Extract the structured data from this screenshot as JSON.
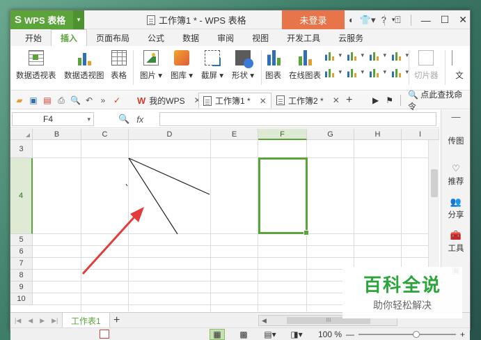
{
  "titlebar": {
    "app_name": "WPS 表格",
    "doc_title": "工作簿1 * - WPS 表格",
    "login": "未登录",
    "help": "?"
  },
  "menu": {
    "tabs": [
      "开始",
      "插入",
      "页面布局",
      "公式",
      "数据",
      "审阅",
      "视图",
      "开发工具",
      "云服务"
    ],
    "active": "插入"
  },
  "ribbon": {
    "pivot_table": "数据透视表",
    "pivot_chart": "数据透视图",
    "table": "表格",
    "picture": "图片",
    "gallery": "图库",
    "screenshot": "截屏",
    "shapes": "形状",
    "chart": "图表",
    "online_chart": "在线图表",
    "slicer": "切片器",
    "text": "文"
  },
  "doctabs": {
    "my_wps": "我的WPS",
    "book1": "工作簿1 *",
    "book2": "工作簿2 *",
    "search": "点此查找命令"
  },
  "formula": {
    "cell_ref": "F4",
    "fx": "fx"
  },
  "grid": {
    "columns": [
      "B",
      "C",
      "D",
      "E",
      "F",
      "G",
      "H",
      "I"
    ],
    "rows": [
      "3",
      "4",
      "5",
      "6",
      "7",
      "8",
      "9",
      "10"
    ],
    "selected_col": "F",
    "selected_row": "4"
  },
  "sidepanel": {
    "items": [
      "传图",
      "推荐",
      "分享",
      "工具"
    ]
  },
  "sheets": {
    "tabs": [
      "工作表1"
    ],
    "scroll_label": "III"
  },
  "status": {
    "zoom": "100 %",
    "zoom_level": 1.0
  },
  "watermark": {
    "title": "百科全说",
    "subtitle": "助你轻松解决"
  },
  "colors": {
    "accent": "#5aa43a",
    "login_bg": "#e8744a",
    "arrow": "#e53a3a"
  }
}
